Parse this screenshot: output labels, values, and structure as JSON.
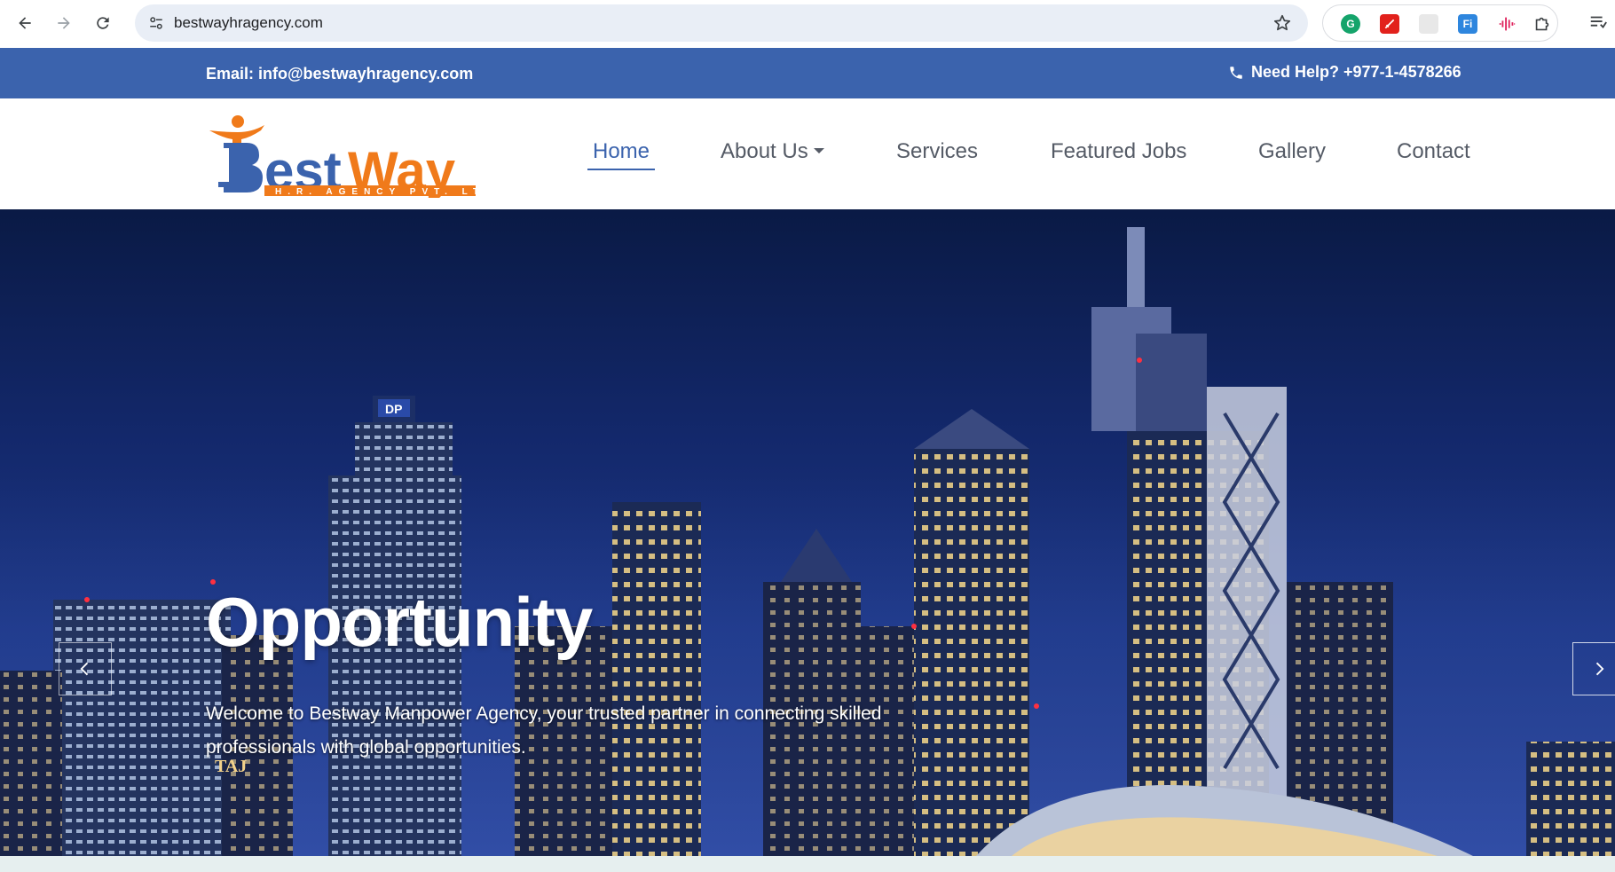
{
  "browser": {
    "url": "bestwayhragency.com",
    "back_icon": "arrow-left-icon",
    "forward_icon": "arrow-right-icon",
    "reload_icon": "reload-icon",
    "bookmark_icon": "star-icon",
    "extensions": [
      "grammarly-icon",
      "pdf-icon",
      "blank-extension-icon",
      "fi-extension-icon",
      "audio-wave-icon",
      "puzzle-icon"
    ],
    "fi_label": "Fi"
  },
  "topbar": {
    "email": "Email: info@bestwayhragency.com",
    "help": "Need Help? +977-1-4578266",
    "background": "#3b63ad"
  },
  "logo": {
    "main": "BestWay",
    "sub": "H.R. AGENCY PVT. LTD."
  },
  "nav": {
    "items": [
      {
        "label": "Home",
        "active": true
      },
      {
        "label": "About Us",
        "dropdown": true
      },
      {
        "label": "Services"
      },
      {
        "label": "Featured Jobs"
      },
      {
        "label": "Gallery"
      },
      {
        "label": "Contact"
      }
    ],
    "active_color": "#3b63ad"
  },
  "hero": {
    "title": "Opportunity",
    "text": "Welcome to Bestway Manpower Agency, your trusted partner in connecting skilled professionals with global opportunities.",
    "prev_icon": "chevron-left-icon",
    "next_icon": "chevron-right-icon",
    "sign_dp": "DP",
    "sign_taj": "TAJ"
  }
}
